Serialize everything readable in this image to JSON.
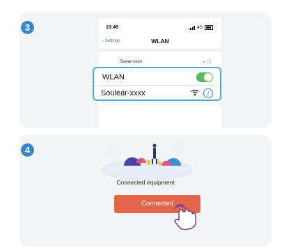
{
  "steps": {
    "step3_number": "3",
    "step4_number": "4"
  },
  "phone": {
    "status_time": "10:46",
    "status_network": "4G",
    "nav_back": "Settings",
    "nav_title": "WLAN",
    "network_row_label": "Suear-xxxx"
  },
  "wlan_box": {
    "wlan_label": "WLAN",
    "wlan_toggle_on": true,
    "network_label": "Soulear-xxxx"
  },
  "connect": {
    "caption": "Connected equipment",
    "button_label": "Connected"
  },
  "colors": {
    "badge": "#3a86c8",
    "highlight_border": "#49a8dc",
    "toggle_on": "#5cb85c",
    "button": "#e2674a"
  }
}
